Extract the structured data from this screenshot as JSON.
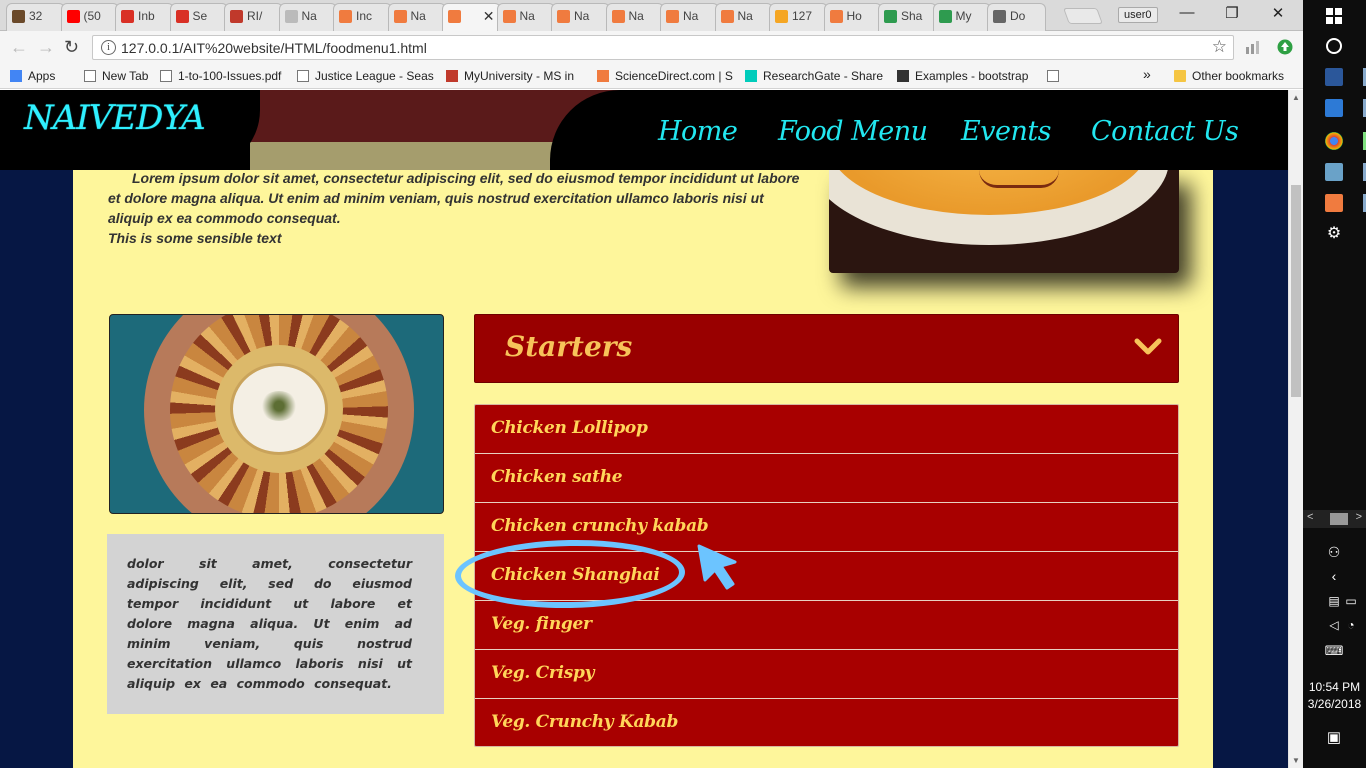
{
  "browser": {
    "tabs": [
      {
        "label": "32",
        "favicon_color": "#6b4a2a"
      },
      {
        "label": "(50",
        "favicon_color": "#ff0000"
      },
      {
        "label": "Inb",
        "favicon_color": "#d93025"
      },
      {
        "label": "Se",
        "favicon_color": "#d93025"
      },
      {
        "label": "RI/",
        "favicon_color": "#c0392b"
      },
      {
        "label": "Na",
        "favicon_color": "#bbbbbb"
      },
      {
        "label": "Inc",
        "favicon_color": "#f07b3f"
      },
      {
        "label": "Na",
        "favicon_color": "#f07b3f"
      },
      {
        "label": "",
        "favicon_color": "#f07b3f"
      },
      {
        "label": "Na",
        "favicon_color": "#f07b3f"
      },
      {
        "label": "Na",
        "favicon_color": "#f07b3f"
      },
      {
        "label": "Na",
        "favicon_color": "#f07b3f"
      },
      {
        "label": "Na",
        "favicon_color": "#f07b3f"
      },
      {
        "label": "Na",
        "favicon_color": "#f07b3f"
      },
      {
        "label": "127",
        "favicon_color": "#f5a623"
      },
      {
        "label": "Ho",
        "favicon_color": "#f07b3f"
      },
      {
        "label": "Sha",
        "favicon_color": "#2e9b4f"
      },
      {
        "label": "My",
        "favicon_color": "#2e9b4f"
      },
      {
        "label": "Do",
        "favicon_color": "#666666"
      }
    ],
    "active_tab_close": "✕",
    "user_label": "user0",
    "window_controls": {
      "minimize": "—",
      "restore": "❐",
      "close": "✕"
    },
    "back": "←",
    "forward": "→",
    "reload": "↻",
    "info_glyph": "i",
    "url": "127.0.0.1/AIT%20website/HTML/foodmenu1.html",
    "star": "☆",
    "bookmarks": [
      {
        "label": "Apps",
        "icon": "apps-grid-icon"
      },
      {
        "label": "New Tab",
        "icon": "page-icon"
      },
      {
        "label": "1-to-100-Issues.pdf",
        "icon": "page-icon"
      },
      {
        "label": "Justice League - Seas",
        "icon": "screen-icon"
      },
      {
        "label": "MyUniversity - MS in",
        "icon": "x-logo-icon"
      },
      {
        "label": "ScienceDirect.com | S",
        "icon": "elsevier-icon"
      },
      {
        "label": "ResearchGate - Share",
        "icon": "researchgate-icon"
      },
      {
        "label": "Examples - bootstrap",
        "icon": "book-icon"
      },
      {
        "label": "",
        "icon": "page-icon"
      }
    ],
    "bookmarks_overflow": "»",
    "other_bookmarks": "Other bookmarks"
  },
  "site": {
    "logo": "NAIVEDYA",
    "nav": [
      "Home",
      "Food Menu",
      "Events",
      "Contact Us"
    ],
    "intro_text": "Lorem ipsum dolor sit amet, consectetur adipiscing elit, sed do eiusmod tempor incididunt ut labore et dolore magna aliqua. Ut enim ad minim veniam, quis nostrud exercitation ullamco laboris nisi ut aliquip ex ea commodo consequat.",
    "sensible_text": "This is some sensible text",
    "side_text": "dolor sit amet, consectetur adipiscing elit, sed do eiusmod tempor incididunt ut labore et dolore magna aliqua. Ut enim ad minim veniam, quis nostrud exercitation ullamco laboris nisi ut aliquip ex ea commodo consequat.",
    "section_title": "Starters",
    "menu_items": [
      "Chicken Lollipop",
      "Chicken sathe",
      "Chicken crunchy kabab",
      "Chicken Shanghai",
      "Veg. finger",
      "Veg. Crispy",
      "Veg. Crunchy Kabab"
    ],
    "colors": {
      "accent_cyan": "#22e7f0",
      "menu_red": "#a80000",
      "menu_text": "#ffd65a",
      "panel_yellow": "#fef69b",
      "annotation_blue": "#6cc4ff"
    }
  },
  "taskbar": {
    "time": "10:54 PM",
    "date": "3/26/2018"
  }
}
